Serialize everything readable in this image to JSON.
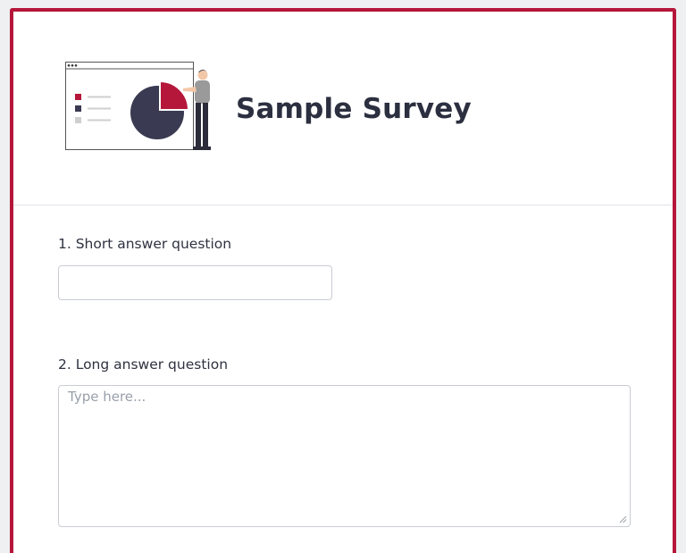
{
  "survey": {
    "title": "Sample Survey"
  },
  "questions": [
    {
      "label": "1. Short answer question",
      "value": "",
      "placeholder": ""
    },
    {
      "label": "2. Long answer question",
      "value": "",
      "placeholder": "Type here..."
    }
  ],
  "colors": {
    "accent": "#b5173a",
    "dark": "#3a3a52",
    "title_text": "#2b2f3f"
  },
  "icons": {
    "header_illustration": "presentation-pie-chart-illustration"
  }
}
